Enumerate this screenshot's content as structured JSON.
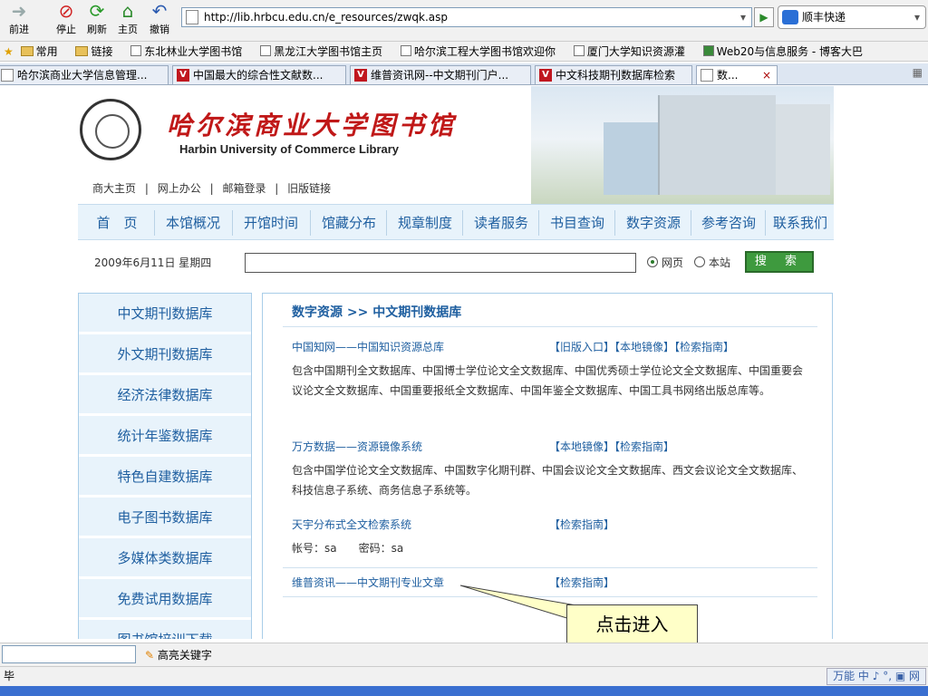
{
  "browser": {
    "buttons": [
      {
        "label": "前进",
        "icon": "forward-arrow-icon"
      },
      {
        "label": "停止",
        "icon": "stop-icon"
      },
      {
        "label": "刷新",
        "icon": "refresh-icon"
      },
      {
        "label": "主页",
        "icon": "home-icon"
      },
      {
        "label": "撤销",
        "icon": "undo-icon"
      }
    ],
    "address": "http://lib.hrbcu.edu.cn/e_resources/zwqk.asp",
    "search_engine": "顺丰快递",
    "favorites": [
      "常用",
      "链接",
      "东北林业大学图书馆",
      "黑龙江大学图书馆主页",
      "哈尔滨工程大学图书馆欢迎你",
      "厦门大学知识资源灌",
      "Web20与信息服务 - 博客大巴"
    ],
    "tabs": [
      {
        "title": "哈尔滨商业大学信息管理...",
        "icon": "page-icon"
      },
      {
        "title": "中国最大的综合性文献数...",
        "icon": "v-icon"
      },
      {
        "title": "维普资讯网--中文期刊门户...",
        "icon": "v-icon"
      },
      {
        "title": "中文科技期刊数据库检索",
        "icon": "v-icon"
      },
      {
        "title": "数...",
        "icon": "page-icon",
        "active": true
      }
    ],
    "tab_close": "×",
    "find_label": "高亮关键字",
    "status": "毕",
    "ime": "万能 中 ♪ °, ▣ 网"
  },
  "site": {
    "logo_cn": "哈尔滨商业大学图书馆",
    "logo_en": "Harbin University of Commerce Library",
    "quick_links": [
      "商大主页",
      "|",
      "网上办公",
      "|",
      "邮箱登录",
      "|",
      "旧版链接"
    ],
    "nav": [
      "首　页",
      "本馆概况",
      "开馆时间",
      "馆藏分布",
      "规章制度",
      "读者服务",
      "书目查询",
      "数字资源",
      "参考咨询",
      "联系我们"
    ],
    "date": "2009年6月11日 星期四",
    "radio_web": "网页",
    "radio_site": "本站",
    "search_button": "搜 索",
    "sidebar": [
      "中文期刊数据库",
      "外文期刊数据库",
      "经济法律数据库",
      "统计年鉴数据库",
      "特色自建数据库",
      "电子图书数据库",
      "多媒体类数据库",
      "免费试用数据库",
      "图书馆培训下载"
    ],
    "breadcrumb": "数字资源 >> 中文期刊数据库",
    "entries": [
      {
        "name": "中国知网——中国知识资源总库",
        "actions": "【旧版入口】【本地镜像】【检索指南】",
        "desc": "包含中国期刊全文数据库、中国博士学位论文全文数据库、中国优秀硕士学位论文全文数据库、中国重要会议论文全文数据库、中国重要报纸全文数据库、中国年鉴全文数据库、中国工具书网络出版总库等。"
      },
      {
        "name": "万方数据——资源镜像系统",
        "actions": "【本地镜像】【检索指南】",
        "desc": "包含中国学位论文全文数据库、中国数字化期刊群、中国会议论文全文数据库、西文会议论文全文数据库、科技信息子系统、商务信息子系统等。"
      },
      {
        "name": "天宇分布式全文检索系统",
        "actions": "【检索指南】",
        "desc": "帐号：sa　　密码：sa"
      },
      {
        "name": "维普资讯——中文期刊专业文章",
        "actions": "【检索指南】",
        "desc": ""
      }
    ],
    "callout": "点击进入"
  },
  "colors": {
    "link": "#1f5fa0",
    "nav_bg": "#e8f3fb",
    "logo_red": "#c01818",
    "button_green": "#3e9a3e",
    "callout_bg": "#ffffc8"
  }
}
